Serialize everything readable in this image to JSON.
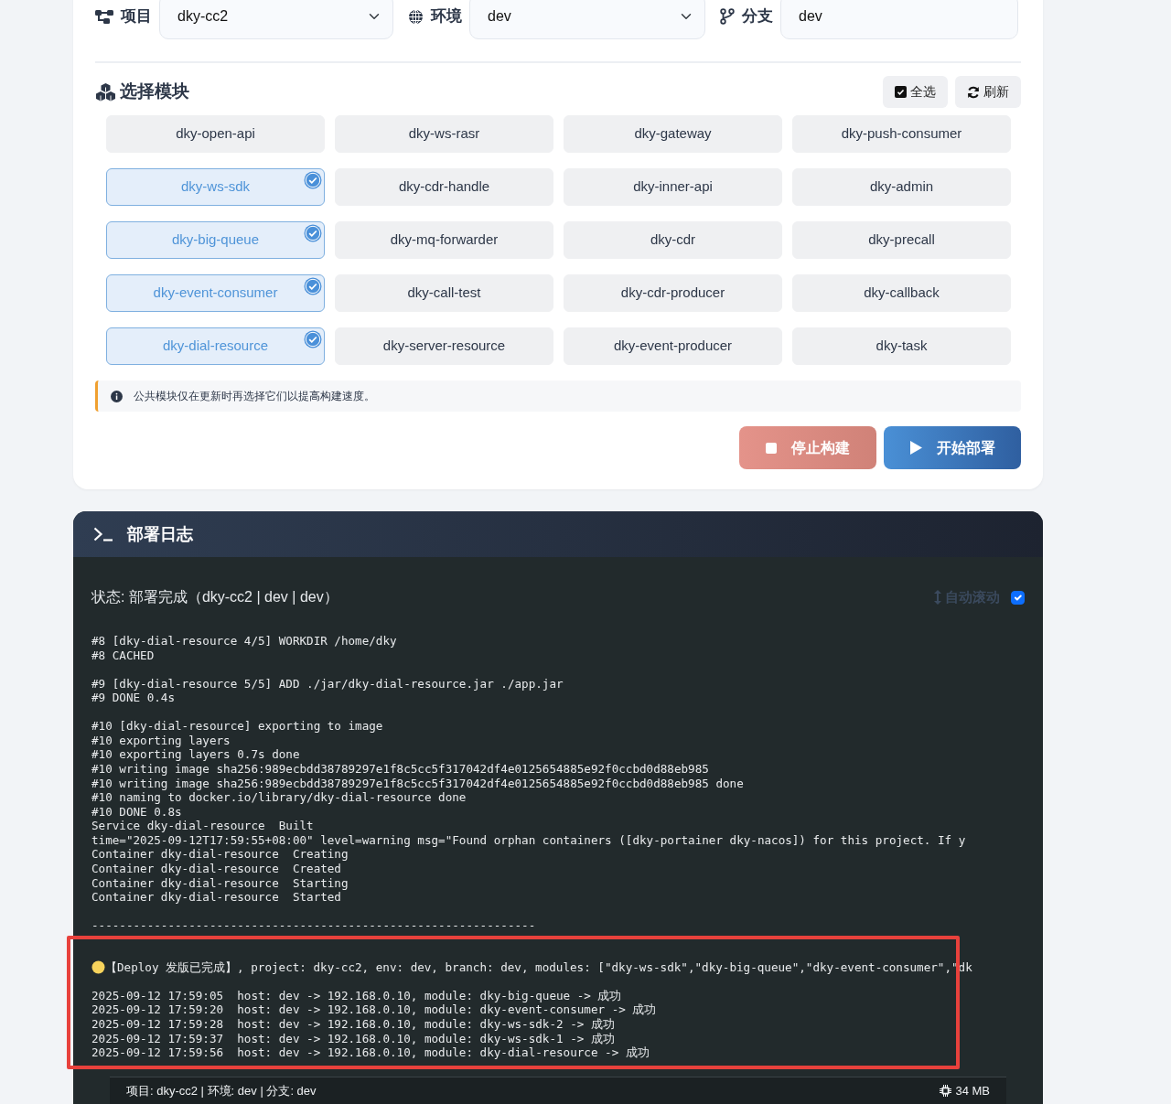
{
  "toolbar": {
    "project": {
      "label": "项目",
      "value": "dky-cc2"
    },
    "environment": {
      "label": "环境",
      "value": "dev"
    },
    "branch": {
      "label": "分支",
      "value": "dev"
    }
  },
  "modules": {
    "title": "选择模块",
    "select_all": "全选",
    "refresh": "刷新",
    "items": [
      {
        "name": "dky-open-api",
        "selected": false
      },
      {
        "name": "dky-ws-rasr",
        "selected": false
      },
      {
        "name": "dky-gateway",
        "selected": false
      },
      {
        "name": "dky-push-consumer",
        "selected": false
      },
      {
        "name": "dky-ws-sdk",
        "selected": true
      },
      {
        "name": "dky-cdr-handle",
        "selected": false
      },
      {
        "name": "dky-inner-api",
        "selected": false
      },
      {
        "name": "dky-admin",
        "selected": false
      },
      {
        "name": "dky-big-queue",
        "selected": true
      },
      {
        "name": "dky-mq-forwarder",
        "selected": false
      },
      {
        "name": "dky-cdr",
        "selected": false
      },
      {
        "name": "dky-precall",
        "selected": false
      },
      {
        "name": "dky-event-consumer",
        "selected": true
      },
      {
        "name": "dky-call-test",
        "selected": false
      },
      {
        "name": "dky-cdr-producer",
        "selected": false
      },
      {
        "name": "dky-callback",
        "selected": false
      },
      {
        "name": "dky-dial-resource",
        "selected": true
      },
      {
        "name": "dky-server-resource",
        "selected": false
      },
      {
        "name": "dky-event-producer",
        "selected": false
      },
      {
        "name": "dky-task",
        "selected": false
      }
    ],
    "note": "公共模块仅在更新时再选择它们以提高构建速度。",
    "stop_button": {
      "label": "停止构建",
      "disabled": true
    },
    "start_button": {
      "label": "开始部署",
      "disabled": false
    }
  },
  "log": {
    "title": "部署日志",
    "status": "状态: 部署完成（dky-cc2 | dev | dev）",
    "auto_scroll": {
      "label": "自动滚动",
      "checked": true
    },
    "blocks": [
      [
        "#8 [dky-dial-resource 4/5] WORKDIR /home/dky",
        "#8 CACHED"
      ],
      [
        "#9 [dky-dial-resource 5/5] ADD ./jar/dky-dial-resource.jar ./app.jar",
        "#9 DONE 0.4s"
      ],
      [
        "#10 [dky-dial-resource] exporting to image",
        "#10 exporting layers",
        "#10 exporting layers 0.7s done",
        "#10 writing image sha256:989ecbdd38789297e1f8c5cc5f317042df4e0125654885e92f0ccbd0d88eb985",
        "#10 writing image sha256:989ecbdd38789297e1f8c5cc5f317042df4e0125654885e92f0ccbd0d88eb985 done",
        "#10 naming to docker.io/library/dky-dial-resource done",
        "#10 DONE 0.8s",
        "Service dky-dial-resource  Built",
        "time=\"2025-09-12T17:59:55+08:00\" level=warning msg=\"Found orphan containers ([dky-portainer dky-nacos]) for this project. If y",
        "Container dky-dial-resource  Creating",
        "Container dky-dial-resource  Created",
        "Container dky-dial-resource  Starting",
        "Container dky-dial-resource  Started"
      ],
      [
        "----------------------------------------------------------------"
      ]
    ],
    "summary": {
      "highlighted": true,
      "headline": "【Deploy 发版已完成】, project: dky-cc2, env: dev, branch: dev, modules: [\"dky-ws-sdk\",\"dky-big-queue\",\"dky-event-consumer\",\"dk",
      "lines": [
        "2025-09-12 17:59:05  host: dev -> 192.168.0.10, module: dky-big-queue -> 成功",
        "2025-09-12 17:59:20  host: dev -> 192.168.0.10, module: dky-event-consumer -> 成功",
        "2025-09-12 17:59:28  host: dev -> 192.168.0.10, module: dky-ws-sdk-2 -> 成功",
        "2025-09-12 17:59:37  host: dev -> 192.168.0.10, module: dky-ws-sdk-1 -> 成功",
        "2025-09-12 17:59:56  host: dev -> 192.168.0.10, module: dky-dial-resource -> 成功"
      ]
    }
  },
  "status_bar": {
    "context": "项目: dky-cc2 | 环境: dev | 分支: dev",
    "memory": "34 MB"
  }
}
